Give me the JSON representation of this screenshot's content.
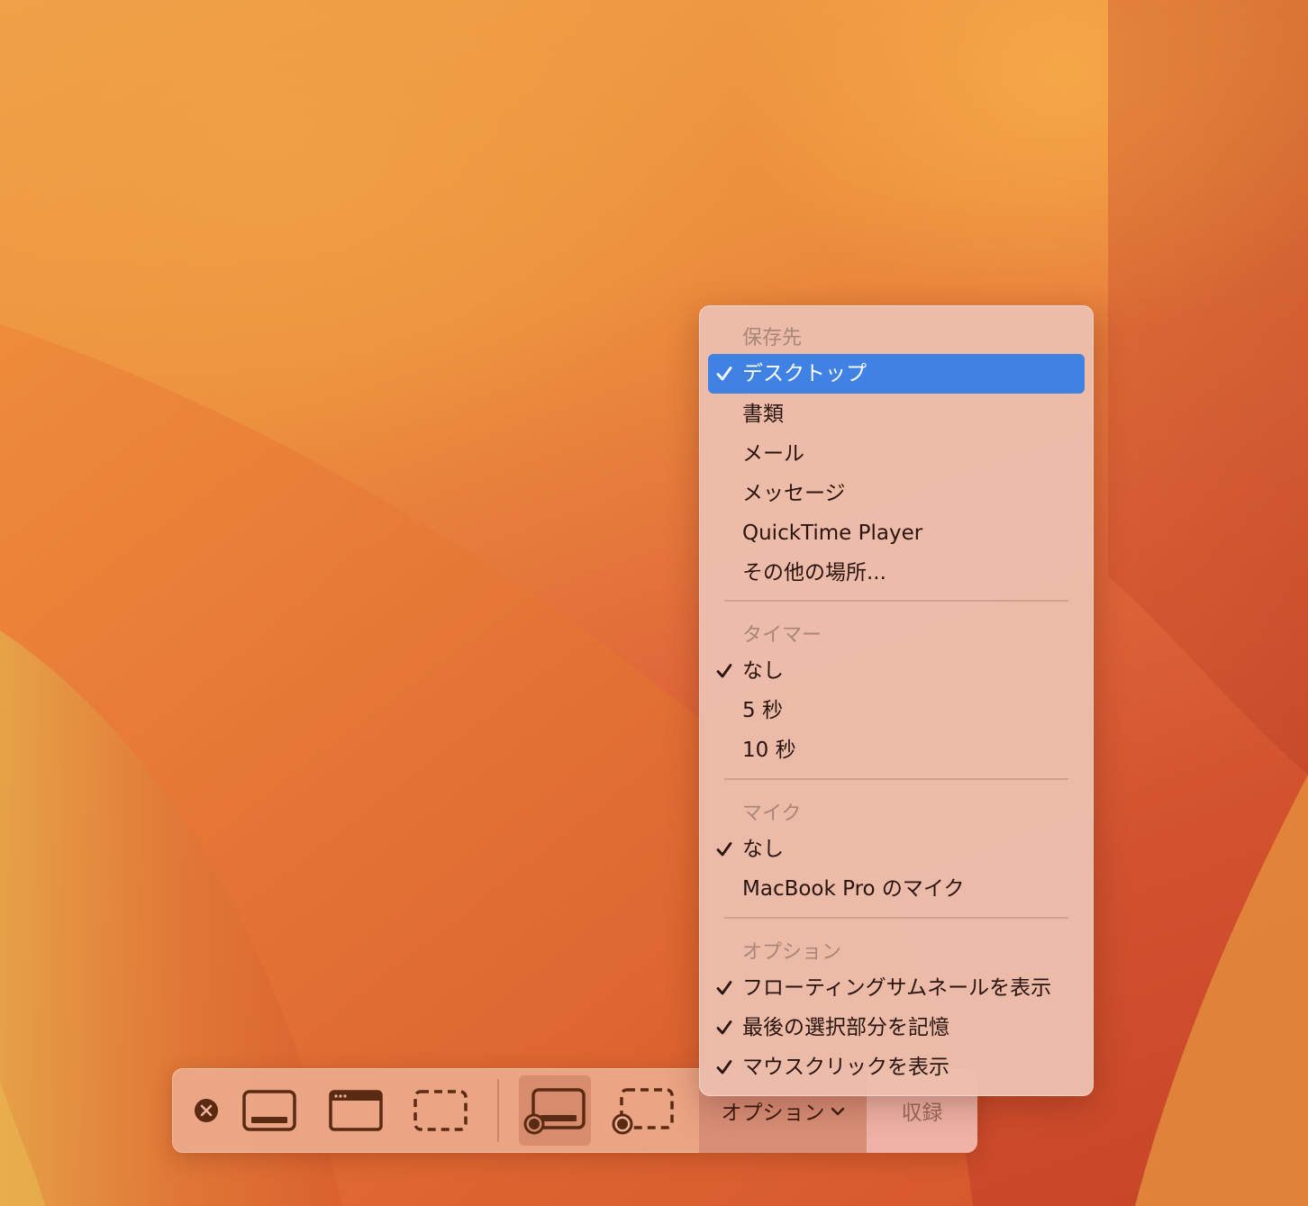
{
  "toolbar": {
    "close_icon": "xmark-circle-icon",
    "capture_entire_screen_icon": "screen-capture-icon",
    "capture_window_icon": "window-capture-icon",
    "capture_selection_icon": "selection-capture-icon",
    "record_entire_screen_icon": "screen-record-icon",
    "record_selection_icon": "selection-record-icon",
    "options_label": "オプション",
    "options_chevron_icon": "chevron-down-icon",
    "record_label": "収録"
  },
  "menu": {
    "save_to": {
      "header": "保存先",
      "items": [
        {
          "label": "デスクトップ",
          "checked": true,
          "highlighted": true
        },
        {
          "label": "書類",
          "checked": false
        },
        {
          "label": "メール",
          "checked": false
        },
        {
          "label": "メッセージ",
          "checked": false
        },
        {
          "label": "QuickTime Player",
          "checked": false
        },
        {
          "label": "その他の場所...",
          "checked": false
        }
      ]
    },
    "timer": {
      "header": "タイマー",
      "items": [
        {
          "label": "なし",
          "checked": true
        },
        {
          "label": "5 秒",
          "checked": false
        },
        {
          "label": "10 秒",
          "checked": false
        }
      ]
    },
    "microphone": {
      "header": "マイク",
      "items": [
        {
          "label": "なし",
          "checked": true
        },
        {
          "label": "MacBook Pro のマイク",
          "checked": false
        }
      ]
    },
    "options": {
      "header": "オプション",
      "items": [
        {
          "label": "フローティングサムネールを表示",
          "checked": true
        },
        {
          "label": "最後の選択部分を記憶",
          "checked": true
        },
        {
          "label": "マウスクリックを表示",
          "checked": true
        }
      ]
    }
  },
  "colors": {
    "highlight": "#3f82e4",
    "icon": "#5a2a12"
  }
}
